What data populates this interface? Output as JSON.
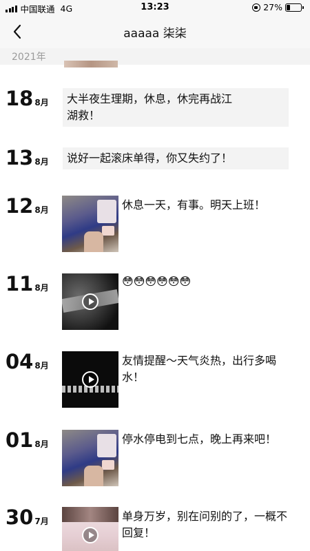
{
  "status_bar": {
    "carrier": "中国联通",
    "network": "4G",
    "time": "13:23",
    "battery_text": "27%",
    "battery_level": 0.27
  },
  "nav": {
    "title": "aaaaa 柒柒",
    "back_icon": "chevron-left-icon"
  },
  "year_header": "2021年",
  "entries": [
    {
      "day": "18",
      "month": "8月",
      "type": "text",
      "text": "大半夜生理期，休息，休完再战江湖救！"
    },
    {
      "day": "13",
      "month": "8月",
      "type": "text",
      "text": "说好一起滚床单得，你又失约了！"
    },
    {
      "day": "12",
      "month": "8月",
      "type": "photo",
      "caption": "休息一天，有事。明天上班！"
    },
    {
      "day": "11",
      "month": "8月",
      "type": "video",
      "caption": "😳😳😳😳😳😳"
    },
    {
      "day": "04",
      "month": "8月",
      "type": "video",
      "caption": "友情提醒～天气炎热，出行多喝水！"
    },
    {
      "day": "01",
      "month": "8月",
      "type": "photo",
      "caption": "停水停电到七点，晚上再来吧！"
    },
    {
      "day": "30",
      "month": "7月",
      "type": "video",
      "caption": "单身万岁，别在问别的了，一概不回复！"
    }
  ],
  "colors": {
    "bar_bg": "#f7f7f7",
    "text_box_bg": "#f3f3f3",
    "year_text": "#9a9a9a"
  }
}
